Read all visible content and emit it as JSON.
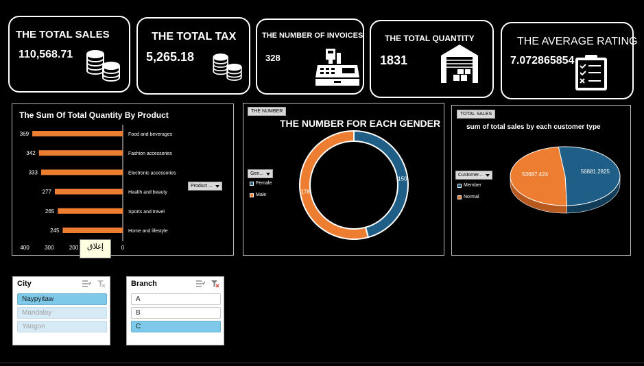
{
  "kpis": {
    "total_sales": {
      "title": "THE TOTAL SALES",
      "value": "110,568.71",
      "icon": "coins-icon"
    },
    "total_tax": {
      "title": "THE TOTAL TAX",
      "value": "5,265.18",
      "icon": "coins-icon"
    },
    "invoices": {
      "title": "THE NUMBER OF INVOICES",
      "value": "328",
      "icon": "cash-register-icon"
    },
    "quantity": {
      "title": "THE TOTAL QUANTITY",
      "value": "1831",
      "icon": "warehouse-icon"
    },
    "rating": {
      "title": "THE AVERAGE RATING",
      "value": "7.072865854",
      "icon": "checklist-clipboard-icon"
    }
  },
  "bar_panel": {
    "title": "The Sum Of Total Quantity By Product",
    "filter_label": "Product ...",
    "tooltip": "إغلاق"
  },
  "gender_panel": {
    "chip": "THE NUMBER",
    "title": "THE NUMBER FOR EACH GENDER",
    "filter_label": "Gen...",
    "legend": [
      "Female",
      "Male"
    ]
  },
  "customer_panel": {
    "chip": "TOTAL SALES",
    "title": "sum of total sales by each customer type",
    "filter_label": "Customer...",
    "legend": [
      "Member",
      "Normal"
    ]
  },
  "city_slicer": {
    "title": "City",
    "items": [
      "Naypyitaw",
      "Mandalay",
      "Yangon"
    ]
  },
  "branch_slicer": {
    "title": "Branch",
    "items": [
      "A",
      "B",
      "C"
    ]
  },
  "colors": {
    "orange": "#ed7d31",
    "blue": "#1f5f87",
    "slicer_selected": "#7ec8ea"
  },
  "chart_data": [
    {
      "type": "bar",
      "orientation": "horizontal",
      "title": "The Sum Of Total Quantity By Product",
      "categories": [
        "Food and beverages",
        "Fashion accessories",
        "Electronic accessories",
        "Health and beauty",
        "Sports and travel",
        "Home and lifestyle"
      ],
      "values": [
        369,
        342,
        333,
        277,
        265,
        245
      ],
      "x_reversed": true,
      "xlim": [
        0,
        400
      ],
      "xticks": [
        400,
        300,
        200,
        100,
        0
      ],
      "xtick_labels": [
        "400",
        "300",
        "200",
        "",
        "0"
      ]
    },
    {
      "type": "pie",
      "style": "donut",
      "title": "THE NUMBER FOR EACH GENDER",
      "categories": [
        "Female",
        "Male"
      ],
      "values": [
        150,
        178
      ]
    },
    {
      "type": "pie",
      "style": "3d",
      "title": "sum of total sales by each customer type",
      "categories": [
        "Member",
        "Normal"
      ],
      "values": [
        56881.2825,
        53687.424
      ]
    }
  ]
}
